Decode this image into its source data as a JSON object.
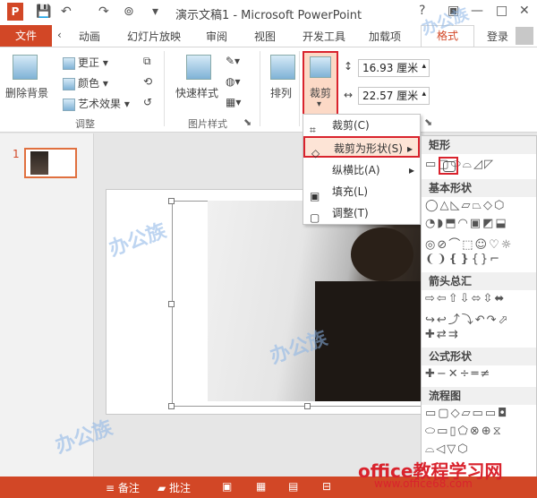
{
  "titlebar": {
    "title": "演示文稿1 - Microsoft PowerPoint",
    "help": "?",
    "minimize": "—",
    "restore": "□",
    "close": "✕"
  },
  "tabs": {
    "file": "文件",
    "animation": "动画",
    "slideshow": "幻灯片放映",
    "review": "审阅",
    "view": "视图",
    "developer": "开发工具",
    "addins": "加载项",
    "format": "格式",
    "login": "登录"
  },
  "ribbon": {
    "remove_bg": "删除背景",
    "corrections": "更正",
    "color": "颜色",
    "art_effects": "艺术效果",
    "adjust_group": "调整",
    "quick_styles": "快速样式",
    "picture_styles_group": "图片样式",
    "arrange": "排列",
    "crop": "裁剪",
    "height_value": "16.93 厘米",
    "width_value": "22.57 厘米"
  },
  "crop_menu": {
    "crop": "裁剪(C)",
    "crop_to_shape": "裁剪为形状(S)",
    "aspect_ratio": "纵横比(A)",
    "fill": "填充(L)",
    "fit": "调整(T)"
  },
  "shape_gallery": {
    "rectangles": "矩形",
    "basic_shapes": "基本形状",
    "block_arrows": "箭头总汇",
    "equation_shapes": "公式形状",
    "flowchart": "流程图",
    "rect_row": "▭▢⬭⌓◿◸",
    "basic_row1": "◯△◺▱⏢◇⬡",
    "basic_row2": "◔◗⬒◠▣◩⬓",
    "basic_row3": "◎⊘⌒⬚☺♡☼",
    "basic_row4": "❨❩❴❵{}⌐",
    "arrow_row1": "⇨⇦⇧⇩⬄⇳⬌",
    "arrow_row2": "↪↩⤴⤵↶↷⬀",
    "arrow_row3": "✚⇄⇉",
    "equation_row": "✚−✕÷═≠",
    "flow_row1": "▭▢◇▱▭▭◘",
    "flow_row2": "⬭▭▯⬠⊗⊕⧖",
    "flow_row3": "⌓◁▽⬡"
  },
  "slide": {
    "number": "1"
  },
  "statusbar": {
    "notes": "备注",
    "comments": "批注"
  },
  "watermark": {
    "site_name": "office教程学习网",
    "site_url": "www.office68.com"
  }
}
